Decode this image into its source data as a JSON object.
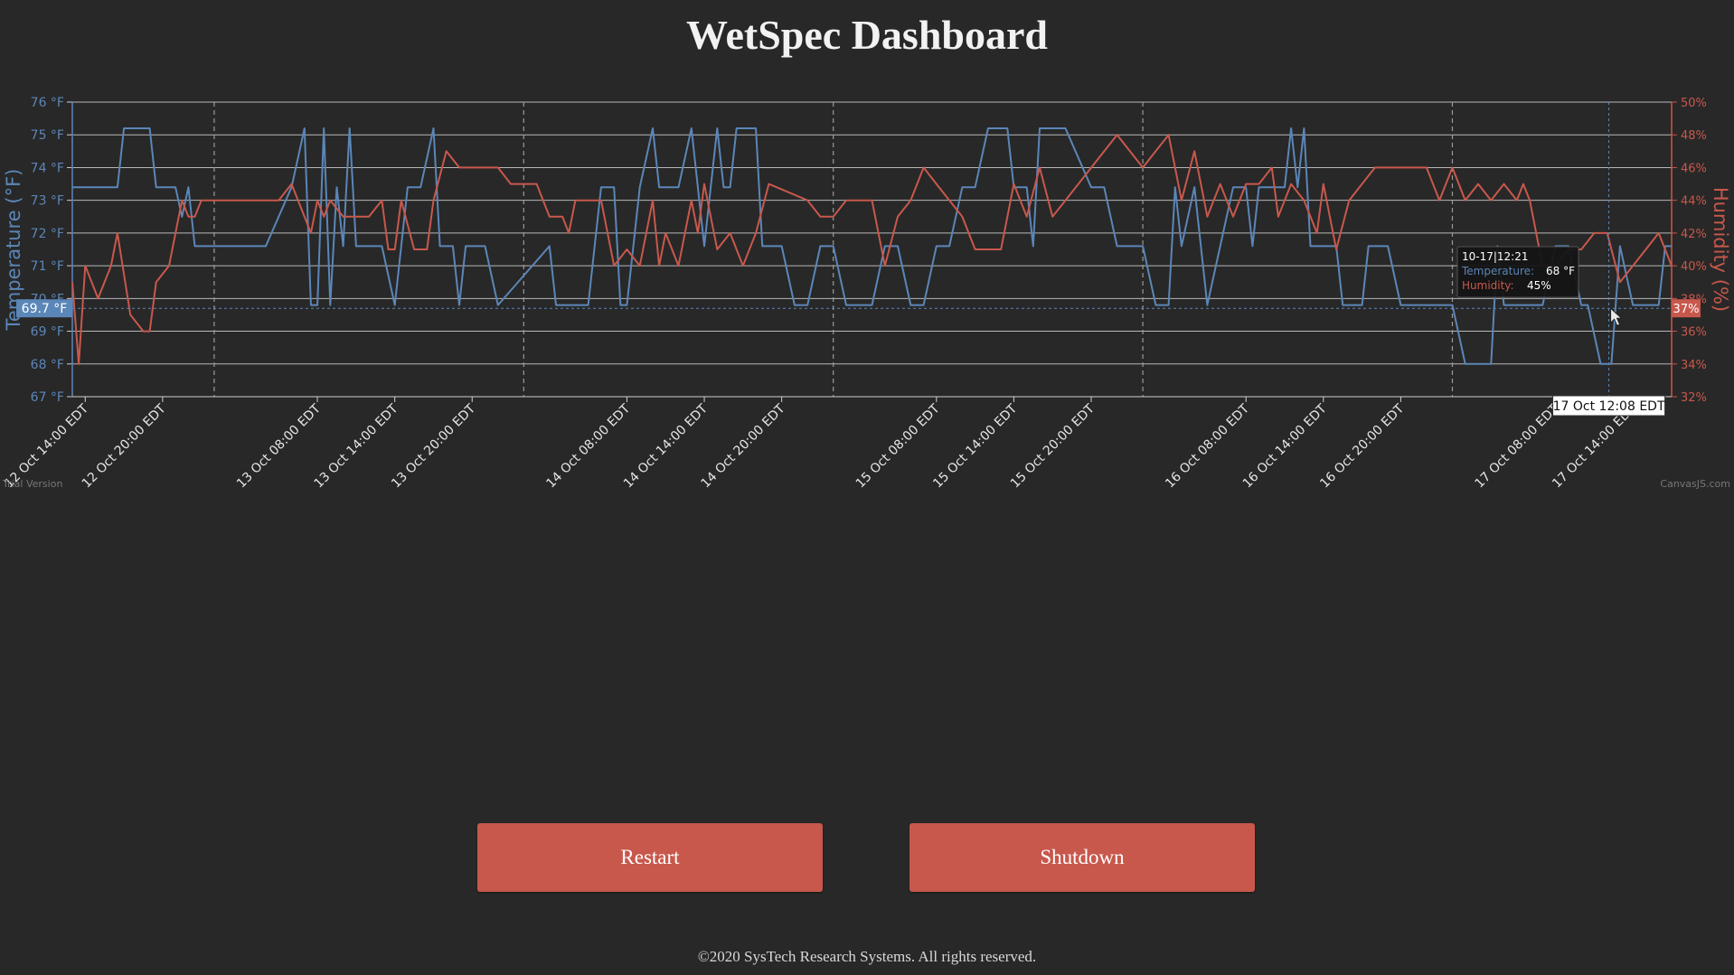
{
  "page": {
    "title": "WetSpec Dashboard",
    "footer": "©2020 SysTech Research Systems. All rights reserved.",
    "buttons": {
      "restart": "Restart",
      "shutdown": "Shutdown"
    }
  },
  "colors": {
    "background": "#282828",
    "temperature": "#5b86b8",
    "humidity": "#c8584c",
    "button": "#c8584c",
    "grid": "#d0d0d0"
  },
  "chart_data": {
    "type": "line",
    "ylabel": "Temperature (°F)",
    "y2label": "Humidity (%)",
    "ylim": [
      67,
      76
    ],
    "y2lim": [
      32,
      50
    ],
    "yticks": [
      "67 °F",
      "68 °F",
      "69 °F",
      "70 °F",
      "71 °F",
      "72 °F",
      "73 °F",
      "74 °F",
      "75 °F",
      "76 °F"
    ],
    "y2ticks": [
      "32%",
      "34%",
      "36%",
      "38%",
      "40%",
      "42%",
      "44%",
      "46%",
      "48%",
      "50%"
    ],
    "x_range": [
      "2020-10-12 13:00",
      "2020-10-17 17:00"
    ],
    "x_ticks": [
      "12 Oct 14:00 EDT",
      "12 Oct 20:00 EDT",
      "13 Oct 08:00 EDT",
      "13 Oct 14:00 EDT",
      "13 Oct 20:00 EDT",
      "14 Oct 08:00 EDT",
      "14 Oct 14:00 EDT",
      "14 Oct 20:00 EDT",
      "15 Oct 08:00 EDT",
      "15 Oct 14:00 EDT",
      "15 Oct 20:00 EDT",
      "16 Oct 08:00 EDT",
      "16 Oct 14:00 EDT",
      "16 Oct 20:00 EDT",
      "17 Oct 08:00 EDT",
      "17 Oct 14:00 EDT"
    ],
    "x_tick_dates": [
      "2020-10-12 14:00",
      "2020-10-12 20:00",
      "2020-10-13 08:00",
      "2020-10-13 14:00",
      "2020-10-13 20:00",
      "2020-10-14 08:00",
      "2020-10-14 14:00",
      "2020-10-14 20:00",
      "2020-10-15 08:00",
      "2020-10-15 14:00",
      "2020-10-15 20:00",
      "2020-10-16 08:00",
      "2020-10-16 14:00",
      "2020-10-16 20:00",
      "2020-10-17 08:00",
      "2020-10-17 14:00"
    ],
    "day_separators": [
      "2020-10-13 00:00",
      "2020-10-14 00:00",
      "2020-10-15 00:00",
      "2020-10-16 00:00",
      "2020-10-17 00:00"
    ],
    "grid": true,
    "series": [
      {
        "name": "Temperature",
        "axis": "left",
        "color": "#5b86b8",
        "points": [
          [
            "2020-10-12 13:00",
            73.4
          ],
          [
            "2020-10-12 16:30",
            73.4
          ],
          [
            "2020-10-12 17:00",
            75.2
          ],
          [
            "2020-10-12 19:00",
            75.2
          ],
          [
            "2020-10-12 19:30",
            73.4
          ],
          [
            "2020-10-12 21:00",
            73.4
          ],
          [
            "2020-10-12 21:30",
            72.5
          ],
          [
            "2020-10-12 22:00",
            73.4
          ],
          [
            "2020-10-12 22:30",
            71.6
          ],
          [
            "2020-10-13 04:00",
            71.6
          ],
          [
            "2020-10-13 06:00",
            73.4
          ],
          [
            "2020-10-13 07:00",
            75.2
          ],
          [
            "2020-10-13 07:30",
            69.8
          ],
          [
            "2020-10-13 08:00",
            69.8
          ],
          [
            "2020-10-13 08:30",
            75.2
          ],
          [
            "2020-10-13 09:00",
            69.8
          ],
          [
            "2020-10-13 09:30",
            73.4
          ],
          [
            "2020-10-13 10:00",
            71.6
          ],
          [
            "2020-10-13 10:30",
            75.2
          ],
          [
            "2020-10-13 11:00",
            71.6
          ],
          [
            "2020-10-13 13:00",
            71.6
          ],
          [
            "2020-10-13 14:00",
            69.8
          ],
          [
            "2020-10-13 15:00",
            73.4
          ],
          [
            "2020-10-13 16:00",
            73.4
          ],
          [
            "2020-10-13 17:00",
            75.2
          ],
          [
            "2020-10-13 17:30",
            71.6
          ],
          [
            "2020-10-13 18:30",
            71.6
          ],
          [
            "2020-10-13 19:00",
            69.8
          ],
          [
            "2020-10-13 19:30",
            71.6
          ],
          [
            "2020-10-13 21:00",
            71.6
          ],
          [
            "2020-10-13 22:00",
            69.8
          ],
          [
            "2020-10-14 02:00",
            71.6
          ],
          [
            "2020-10-14 02:30",
            69.8
          ],
          [
            "2020-10-14 05:00",
            69.8
          ],
          [
            "2020-10-14 06:00",
            73.4
          ],
          [
            "2020-10-14 07:00",
            73.4
          ],
          [
            "2020-10-14 07:30",
            69.8
          ],
          [
            "2020-10-14 08:00",
            69.8
          ],
          [
            "2020-10-14 09:00",
            73.4
          ],
          [
            "2020-10-14 10:00",
            75.2
          ],
          [
            "2020-10-14 10:30",
            73.4
          ],
          [
            "2020-10-14 12:00",
            73.4
          ],
          [
            "2020-10-14 13:00",
            75.2
          ],
          [
            "2020-10-14 14:00",
            71.6
          ],
          [
            "2020-10-14 15:00",
            75.2
          ],
          [
            "2020-10-14 15:30",
            73.4
          ],
          [
            "2020-10-14 16:00",
            73.4
          ],
          [
            "2020-10-14 16:30",
            75.2
          ],
          [
            "2020-10-14 18:00",
            75.2
          ],
          [
            "2020-10-14 18:30",
            71.6
          ],
          [
            "2020-10-14 20:00",
            71.6
          ],
          [
            "2020-10-14 21:00",
            69.8
          ],
          [
            "2020-10-14 22:00",
            69.8
          ],
          [
            "2020-10-14 23:00",
            71.6
          ],
          [
            "2020-10-15 00:00",
            71.6
          ],
          [
            "2020-10-15 01:00",
            69.8
          ],
          [
            "2020-10-15 03:00",
            69.8
          ],
          [
            "2020-10-15 04:00",
            71.6
          ],
          [
            "2020-10-15 05:00",
            71.6
          ],
          [
            "2020-10-15 06:00",
            69.8
          ],
          [
            "2020-10-15 07:00",
            69.8
          ],
          [
            "2020-10-15 08:00",
            71.6
          ],
          [
            "2020-10-15 09:00",
            71.6
          ],
          [
            "2020-10-15 10:00",
            73.4
          ],
          [
            "2020-10-15 11:00",
            73.4
          ],
          [
            "2020-10-15 12:00",
            75.2
          ],
          [
            "2020-10-15 13:30",
            75.2
          ],
          [
            "2020-10-15 14:00",
            73.4
          ],
          [
            "2020-10-15 15:00",
            73.4
          ],
          [
            "2020-10-15 15:30",
            71.6
          ],
          [
            "2020-10-15 16:00",
            75.2
          ],
          [
            "2020-10-15 18:00",
            75.2
          ],
          [
            "2020-10-15 20:00",
            73.4
          ],
          [
            "2020-10-15 21:00",
            73.4
          ],
          [
            "2020-10-15 22:00",
            71.6
          ],
          [
            "2020-10-16 00:00",
            71.6
          ],
          [
            "2020-10-16 01:00",
            69.8
          ],
          [
            "2020-10-16 02:00",
            69.8
          ],
          [
            "2020-10-16 02:30",
            73.4
          ],
          [
            "2020-10-16 03:00",
            71.6
          ],
          [
            "2020-10-16 04:00",
            73.4
          ],
          [
            "2020-10-16 05:00",
            69.8
          ],
          [
            "2020-10-16 06:00",
            71.6
          ],
          [
            "2020-10-16 07:00",
            73.4
          ],
          [
            "2020-10-16 08:00",
            73.4
          ],
          [
            "2020-10-16 08:30",
            71.6
          ],
          [
            "2020-10-16 09:00",
            73.4
          ],
          [
            "2020-10-16 11:00",
            73.4
          ],
          [
            "2020-10-16 11:30",
            75.2
          ],
          [
            "2020-10-16 12:00",
            73.4
          ],
          [
            "2020-10-16 12:30",
            75.2
          ],
          [
            "2020-10-16 13:00",
            71.6
          ],
          [
            "2020-10-16 15:00",
            71.6
          ],
          [
            "2020-10-16 15:30",
            69.8
          ],
          [
            "2020-10-16 17:00",
            69.8
          ],
          [
            "2020-10-16 17:30",
            71.6
          ],
          [
            "2020-10-16 19:00",
            71.6
          ],
          [
            "2020-10-16 20:00",
            69.8
          ],
          [
            "2020-10-16 21:00",
            69.8
          ],
          [
            "2020-10-16 22:00",
            69.8
          ],
          [
            "2020-10-17 00:00",
            69.8
          ],
          [
            "2020-10-17 01:00",
            68.0
          ],
          [
            "2020-10-17 03:00",
            68.0
          ],
          [
            "2020-10-17 03:30",
            71.6
          ],
          [
            "2020-10-17 04:00",
            69.8
          ],
          [
            "2020-10-17 07:00",
            69.8
          ],
          [
            "2020-10-17 08:00",
            71.6
          ],
          [
            "2020-10-17 09:00",
            71.6
          ],
          [
            "2020-10-17 10:00",
            69.8
          ],
          [
            "2020-10-17 10:30",
            69.8
          ],
          [
            "2020-10-17 11:30",
            68.0
          ],
          [
            "2020-10-17 12:20",
            68.0
          ],
          [
            "2020-10-17 13:00",
            71.6
          ],
          [
            "2020-10-17 14:00",
            69.8
          ],
          [
            "2020-10-17 16:00",
            69.8
          ],
          [
            "2020-10-17 16:30",
            71.6
          ],
          [
            "2020-10-17 17:00",
            71.6
          ]
        ]
      },
      {
        "name": "Humidity",
        "axis": "right",
        "color": "#c8584c",
        "points": [
          [
            "2020-10-12 13:00",
            39
          ],
          [
            "2020-10-12 13:30",
            34
          ],
          [
            "2020-10-12 14:00",
            40
          ],
          [
            "2020-10-12 15:00",
            38
          ],
          [
            "2020-10-12 16:00",
            40
          ],
          [
            "2020-10-12 16:30",
            42
          ],
          [
            "2020-10-12 17:30",
            37
          ],
          [
            "2020-10-12 18:30",
            36
          ],
          [
            "2020-10-12 19:00",
            36
          ],
          [
            "2020-10-12 19:30",
            39
          ],
          [
            "2020-10-12 20:30",
            40
          ],
          [
            "2020-10-12 21:30",
            44
          ],
          [
            "2020-10-12 22:00",
            43
          ],
          [
            "2020-10-12 22:30",
            43
          ],
          [
            "2020-10-12 23:00",
            44
          ],
          [
            "2020-10-13 05:00",
            44
          ],
          [
            "2020-10-13 06:00",
            45
          ],
          [
            "2020-10-13 07:00",
            43
          ],
          [
            "2020-10-13 07:30",
            42
          ],
          [
            "2020-10-13 08:00",
            44
          ],
          [
            "2020-10-13 08:30",
            43
          ],
          [
            "2020-10-13 09:00",
            44
          ],
          [
            "2020-10-13 10:00",
            43
          ],
          [
            "2020-10-13 12:00",
            43
          ],
          [
            "2020-10-13 13:00",
            44
          ],
          [
            "2020-10-13 13:30",
            41
          ],
          [
            "2020-10-13 14:00",
            41
          ],
          [
            "2020-10-13 14:30",
            44
          ],
          [
            "2020-10-13 15:30",
            41
          ],
          [
            "2020-10-13 16:30",
            41
          ],
          [
            "2020-10-13 17:00",
            44
          ],
          [
            "2020-10-13 18:00",
            47
          ],
          [
            "2020-10-13 19:00",
            46
          ],
          [
            "2020-10-13 22:00",
            46
          ],
          [
            "2020-10-13 23:00",
            45
          ],
          [
            "2020-10-14 01:00",
            45
          ],
          [
            "2020-10-14 02:00",
            43
          ],
          [
            "2020-10-14 03:00",
            43
          ],
          [
            "2020-10-14 03:30",
            42
          ],
          [
            "2020-10-14 04:00",
            44
          ],
          [
            "2020-10-14 06:00",
            44
          ],
          [
            "2020-10-14 07:00",
            40
          ],
          [
            "2020-10-14 08:00",
            41
          ],
          [
            "2020-10-14 09:00",
            40
          ],
          [
            "2020-10-14 10:00",
            44
          ],
          [
            "2020-10-14 10:30",
            40
          ],
          [
            "2020-10-14 11:00",
            42
          ],
          [
            "2020-10-14 12:00",
            40
          ],
          [
            "2020-10-14 13:00",
            44
          ],
          [
            "2020-10-14 13:30",
            42
          ],
          [
            "2020-10-14 14:00",
            45
          ],
          [
            "2020-10-14 15:00",
            41
          ],
          [
            "2020-10-14 16:00",
            42
          ],
          [
            "2020-10-14 17:00",
            40
          ],
          [
            "2020-10-14 18:00",
            42
          ],
          [
            "2020-10-14 19:00",
            45
          ],
          [
            "2020-10-14 22:00",
            44
          ],
          [
            "2020-10-14 23:00",
            43
          ],
          [
            "2020-10-15 00:00",
            43
          ],
          [
            "2020-10-15 01:00",
            44
          ],
          [
            "2020-10-15 03:00",
            44
          ],
          [
            "2020-10-15 04:00",
            40
          ],
          [
            "2020-10-15 05:00",
            43
          ],
          [
            "2020-10-15 06:00",
            44
          ],
          [
            "2020-10-15 07:00",
            46
          ],
          [
            "2020-10-15 08:00",
            45
          ],
          [
            "2020-10-15 09:00",
            44
          ],
          [
            "2020-10-15 10:00",
            43
          ],
          [
            "2020-10-15 11:00",
            41
          ],
          [
            "2020-10-15 13:00",
            41
          ],
          [
            "2020-10-15 14:00",
            45
          ],
          [
            "2020-10-15 15:00",
            43
          ],
          [
            "2020-10-15 16:00",
            46
          ],
          [
            "2020-10-15 17:00",
            43
          ],
          [
            "2020-10-15 18:00",
            44
          ],
          [
            "2020-10-15 19:00",
            45
          ],
          [
            "2020-10-15 22:00",
            48
          ],
          [
            "2020-10-16 00:00",
            46
          ],
          [
            "2020-10-16 02:00",
            48
          ],
          [
            "2020-10-16 03:00",
            44
          ],
          [
            "2020-10-16 04:00",
            47
          ],
          [
            "2020-10-16 05:00",
            43
          ],
          [
            "2020-10-16 06:00",
            45
          ],
          [
            "2020-10-16 07:00",
            43
          ],
          [
            "2020-10-16 08:00",
            45
          ],
          [
            "2020-10-16 09:00",
            45
          ],
          [
            "2020-10-16 10:00",
            46
          ],
          [
            "2020-10-16 10:30",
            43
          ],
          [
            "2020-10-16 11:30",
            45
          ],
          [
            "2020-10-16 12:30",
            44
          ],
          [
            "2020-10-16 13:30",
            42
          ],
          [
            "2020-10-16 14:00",
            45
          ],
          [
            "2020-10-16 15:00",
            41
          ],
          [
            "2020-10-16 16:00",
            44
          ],
          [
            "2020-10-16 18:00",
            46
          ],
          [
            "2020-10-16 22:00",
            46
          ],
          [
            "2020-10-16 23:00",
            44
          ],
          [
            "2020-10-17 00:00",
            46
          ],
          [
            "2020-10-17 01:00",
            44
          ],
          [
            "2020-10-17 02:00",
            45
          ],
          [
            "2020-10-17 03:00",
            44
          ],
          [
            "2020-10-17 04:00",
            45
          ],
          [
            "2020-10-17 05:00",
            44
          ],
          [
            "2020-10-17 05:30",
            45
          ],
          [
            "2020-10-17 06:00",
            44
          ],
          [
            "2020-10-17 07:00",
            40
          ],
          [
            "2020-10-17 08:00",
            40
          ],
          [
            "2020-10-17 09:00",
            41
          ],
          [
            "2020-10-17 10:00",
            41
          ],
          [
            "2020-10-17 11:00",
            42
          ],
          [
            "2020-10-17 12:00",
            42
          ],
          [
            "2020-10-17 13:00",
            39
          ],
          [
            "2020-10-17 14:00",
            40
          ],
          [
            "2020-10-17 15:00",
            41
          ],
          [
            "2020-10-17 16:00",
            42
          ],
          [
            "2020-10-17 17:00",
            40
          ]
        ]
      }
    ],
    "crosshair": {
      "x_time": "2020-10-17 12:08",
      "x_label": "17 Oct 12:08 EDT",
      "y_value": 69.7,
      "y_label": "69.7 °F",
      "y2_label": "37%"
    },
    "tooltip": {
      "header": "10-17|12:21",
      "rows": [
        {
          "label": "Temperature:",
          "value": "68 °F",
          "color": "#5b86b8"
        },
        {
          "label": "Humidity:",
          "value": "45%",
          "color": "#c8584c"
        }
      ]
    },
    "watermarks": {
      "left": "Trial Version",
      "right": "CanvasJS.com"
    }
  }
}
